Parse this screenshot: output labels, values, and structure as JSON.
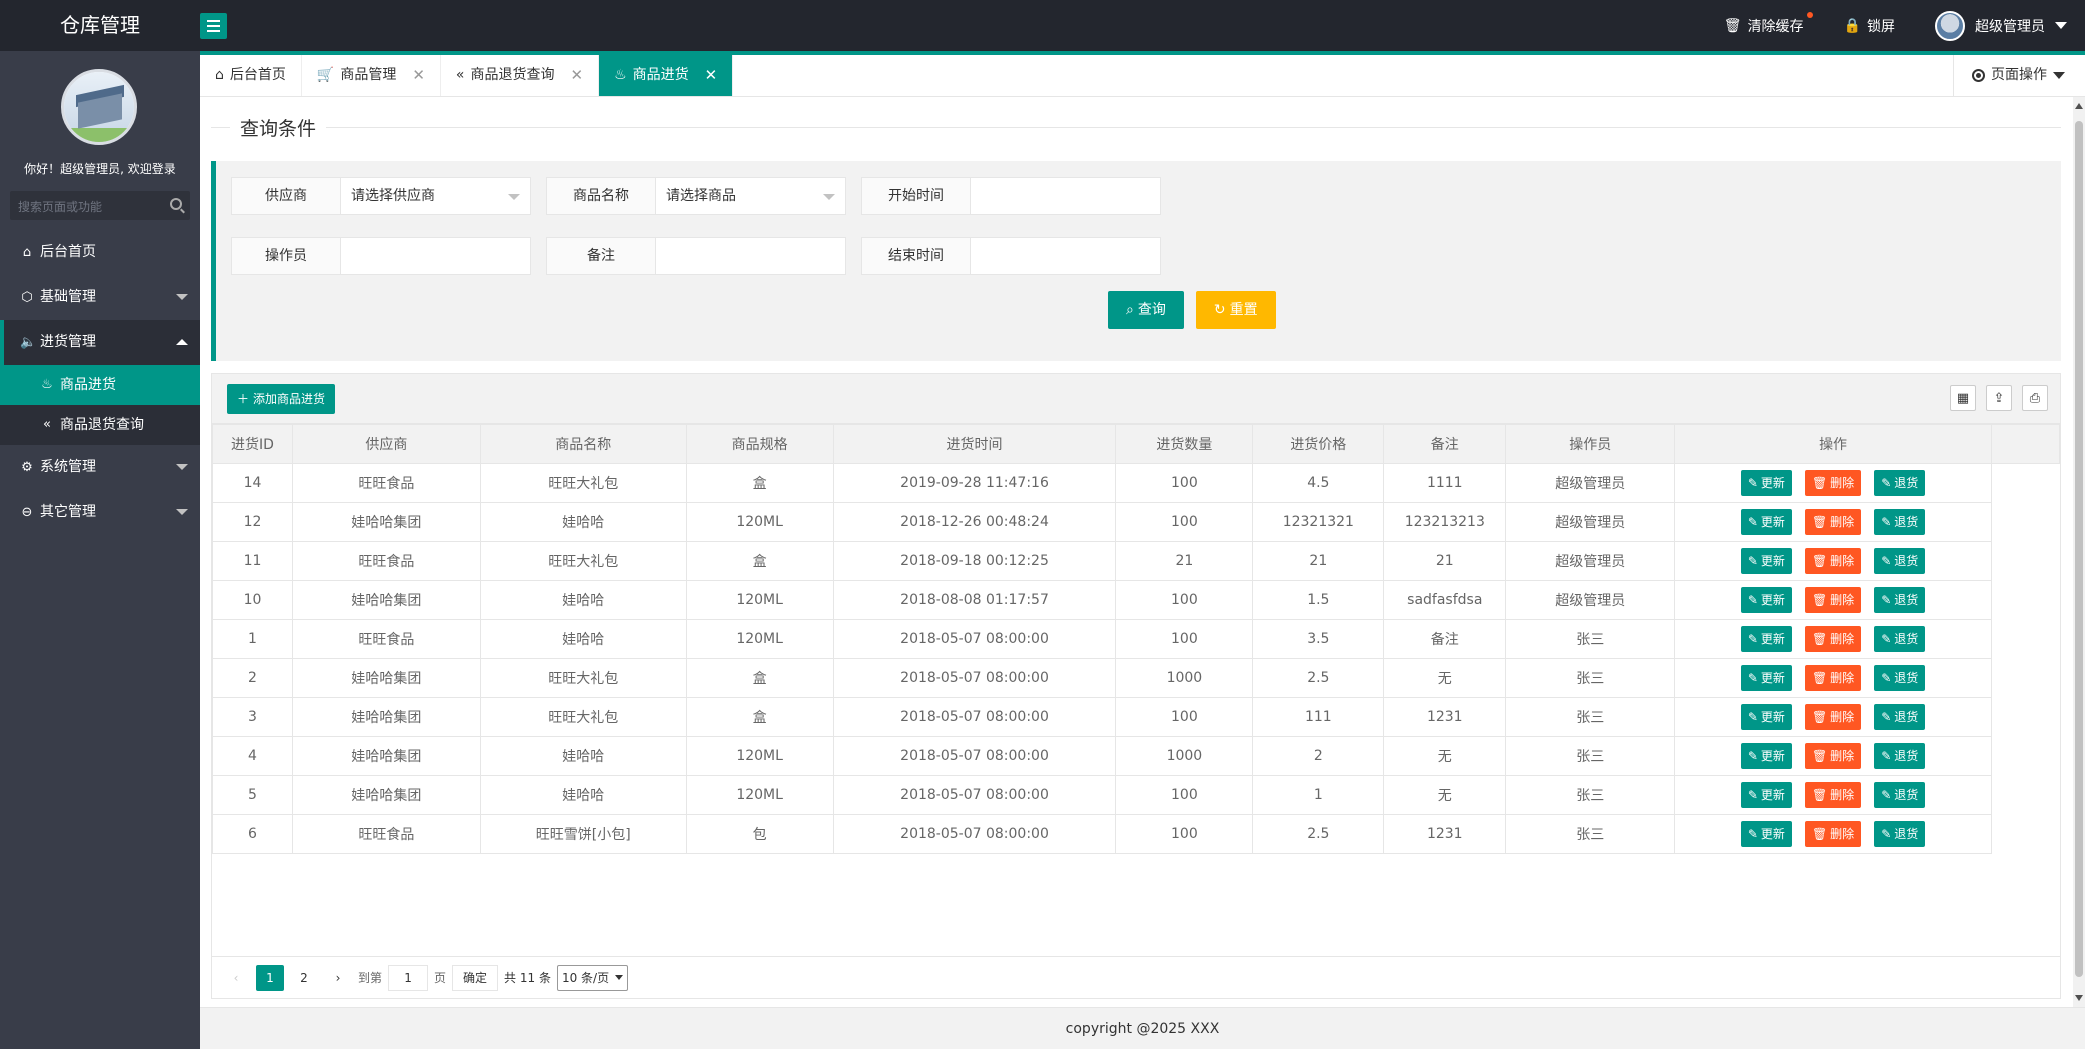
{
  "app": {
    "title": "仓库管理",
    "footer": "copyright @2025 XXX"
  },
  "topbar": {
    "clear_cache": "清除缓存",
    "lock_screen": "锁屏",
    "user_name": "超级管理员"
  },
  "sidebar": {
    "welcome": "你好！超级管理员, 欢迎登录",
    "search_placeholder": "搜索页面或功能",
    "items": [
      {
        "label": "后台首页",
        "icon": "home-icon"
      },
      {
        "label": "基础管理",
        "icon": "cube-icon"
      },
      {
        "label": "进货管理",
        "icon": "speaker-icon"
      },
      {
        "label": "系统管理",
        "icon": "gear-icon"
      },
      {
        "label": "其它管理",
        "icon": "exit-icon"
      }
    ],
    "sub_items": [
      {
        "label": "商品进货",
        "icon": "fire-icon"
      },
      {
        "label": "商品退货查询",
        "icon": "double-left-icon"
      }
    ]
  },
  "tabs": [
    {
      "label": "后台首页",
      "icon": "home-icon"
    },
    {
      "label": "商品管理",
      "icon": "cart-icon"
    },
    {
      "label": "商品退货查询",
      "icon": "double-left-icon"
    },
    {
      "label": "商品进货",
      "icon": "fire-icon"
    }
  ],
  "page_ops": "页面操作",
  "query": {
    "legend": "查询条件",
    "supplier_label": "供应商",
    "supplier_value": "请选择供应商",
    "goods_label": "商品名称",
    "goods_value": "请选择商品",
    "start_label": "开始时间",
    "start_value": "",
    "operator_label": "操作员",
    "operator_value": "",
    "remark_label": "备注",
    "remark_value": "",
    "end_label": "结束时间",
    "end_value": "",
    "search_btn": "查询",
    "reset_btn": "重置"
  },
  "table": {
    "add_btn": "添加商品进货",
    "headers": [
      "进货ID",
      "供应商",
      "商品名称",
      "商品规格",
      "进货时间",
      "进货数量",
      "进货价格",
      "备注",
      "操作员",
      "操作"
    ],
    "op_update": "更新",
    "op_delete": "删除",
    "op_return": "退货",
    "rows": [
      [
        "14",
        "旺旺食品",
        "旺旺大礼包",
        "盒",
        "2019-09-28 11:47:16",
        "100",
        "4.5",
        "1111",
        "超级管理员"
      ],
      [
        "12",
        "娃哈哈集团",
        "娃哈哈",
        "120ML",
        "2018-12-26 00:48:24",
        "100",
        "12321321",
        "123213213",
        "超级管理员"
      ],
      [
        "11",
        "旺旺食品",
        "旺旺大礼包",
        "盒",
        "2018-09-18 00:12:25",
        "21",
        "21",
        "21",
        "超级管理员"
      ],
      [
        "10",
        "娃哈哈集团",
        "娃哈哈",
        "120ML",
        "2018-08-08 01:17:57",
        "100",
        "1.5",
        "sadfasfdsa",
        "超级管理员"
      ],
      [
        "1",
        "旺旺食品",
        "娃哈哈",
        "120ML",
        "2018-05-07 08:00:00",
        "100",
        "3.5",
        "备注",
        "张三"
      ],
      [
        "2",
        "娃哈哈集团",
        "旺旺大礼包",
        "盒",
        "2018-05-07 08:00:00",
        "1000",
        "2.5",
        "无",
        "张三"
      ],
      [
        "3",
        "娃哈哈集团",
        "旺旺大礼包",
        "盒",
        "2018-05-07 08:00:00",
        "100",
        "111",
        "1231",
        "张三"
      ],
      [
        "4",
        "娃哈哈集团",
        "娃哈哈",
        "120ML",
        "2018-05-07 08:00:00",
        "1000",
        "2",
        "无",
        "张三"
      ],
      [
        "5",
        "娃哈哈集团",
        "娃哈哈",
        "120ML",
        "2018-05-07 08:00:00",
        "100",
        "1",
        "无",
        "张三"
      ],
      [
        "6",
        "旺旺食品",
        "旺旺雪饼[小包]",
        "包",
        "2018-05-07 08:00:00",
        "100",
        "2.5",
        "1231",
        "张三"
      ]
    ]
  },
  "pager": {
    "page1": "1",
    "page2": "2",
    "goto_label": "到第",
    "goto_value": "1",
    "page_unit": "页",
    "confirm": "确定",
    "total": "共 11 条",
    "per_page": "10 条/页"
  },
  "colors": {
    "accent": "#009688",
    "warning": "#ffb800",
    "danger": "#ff5722",
    "dark": "#23262e",
    "sidebar": "#393d49"
  }
}
